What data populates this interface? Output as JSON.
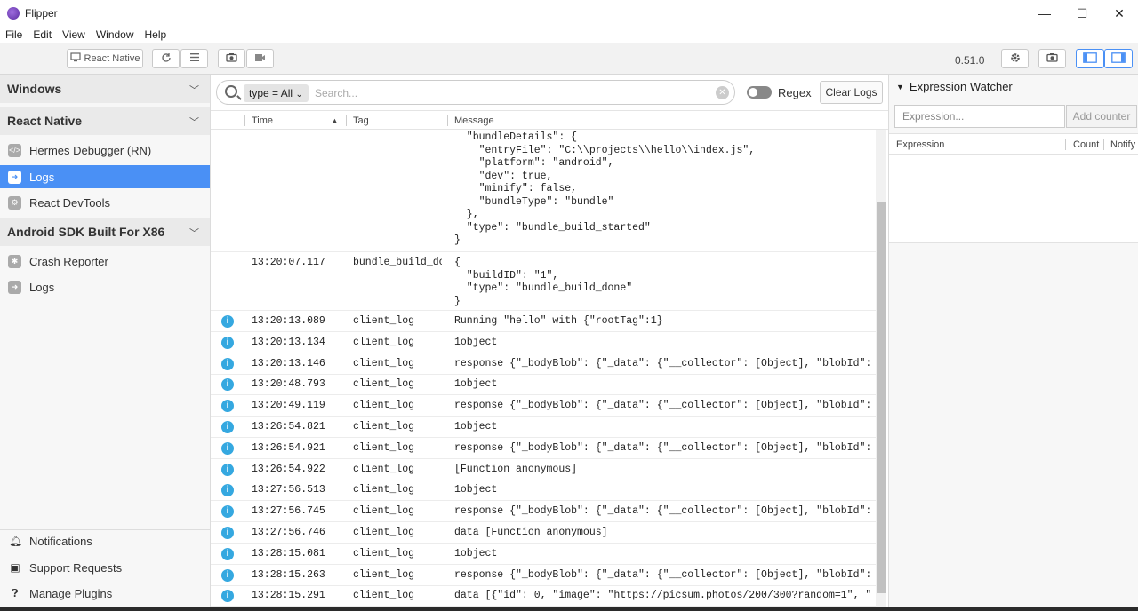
{
  "window": {
    "title": "Flipper",
    "minimize": "—",
    "maximize": "☐",
    "close": "✕"
  },
  "menu": [
    "File",
    "Edit",
    "View",
    "Window",
    "Help"
  ],
  "toolbar": {
    "device_button": "React Native",
    "version": "0.51.0"
  },
  "sidebar": {
    "sections": [
      {
        "title": "Windows"
      },
      {
        "title": "React Native",
        "items": [
          "Hermes Debugger (RN)",
          "Logs",
          "React DevTools"
        ]
      },
      {
        "title": "Android SDK Built For X86",
        "items": [
          "Crash Reporter",
          "Logs"
        ]
      }
    ],
    "footer": [
      "Notifications",
      "Support Requests",
      "Manage Plugins"
    ]
  },
  "logs": {
    "filter_token": "type = All",
    "search_placeholder": "Search...",
    "regex_label": "Regex",
    "clear_button": "Clear Logs",
    "columns": {
      "time": "Time",
      "tag": "Tag",
      "message": "Message"
    },
    "json_block_1": "  \"bundleDetails\": {\n    \"entryFile\": \"C:\\\\projects\\\\hello\\\\index.js\",\n    \"platform\": \"android\",\n    \"dev\": true,\n    \"minify\": false,\n    \"bundleType\": \"bundle\"\n  },\n  \"type\": \"bundle_build_started\"\n}",
    "entry_2": {
      "time": "13:20:07.117",
      "tag": "bundle_build_done",
      "message": "{\n  \"buildID\": \"1\",\n  \"type\": \"bundle_build_done\"\n}"
    },
    "rows": [
      {
        "time": "13:20:13.089",
        "tag": "client_log",
        "message": "Running \"hello\" with {\"rootTag\":1}"
      },
      {
        "time": "13:20:13.134",
        "tag": "client_log",
        "message": "1object"
      },
      {
        "time": "13:20:13.146",
        "tag": "client_log",
        "message": "response {\"_bodyBlob\": {\"_data\": {\"__collector\": [Object], \"blobId\":"
      },
      {
        "time": "13:20:48.793",
        "tag": "client_log",
        "message": "1object"
      },
      {
        "time": "13:20:49.119",
        "tag": "client_log",
        "message": "response {\"_bodyBlob\": {\"_data\": {\"__collector\": [Object], \"blobId\":"
      },
      {
        "time": "13:26:54.821",
        "tag": "client_log",
        "message": "1object"
      },
      {
        "time": "13:26:54.921",
        "tag": "client_log",
        "message": "response {\"_bodyBlob\": {\"_data\": {\"__collector\": [Object], \"blobId\":"
      },
      {
        "time": "13:26:54.922",
        "tag": "client_log",
        "message": "[Function anonymous]"
      },
      {
        "time": "13:27:56.513",
        "tag": "client_log",
        "message": "1object"
      },
      {
        "time": "13:27:56.745",
        "tag": "client_log",
        "message": "response {\"_bodyBlob\": {\"_data\": {\"__collector\": [Object], \"blobId\":"
      },
      {
        "time": "13:27:56.746",
        "tag": "client_log",
        "message": "data [Function anonymous]"
      },
      {
        "time": "13:28:15.081",
        "tag": "client_log",
        "message": "1object"
      },
      {
        "time": "13:28:15.263",
        "tag": "client_log",
        "message": "response {\"_bodyBlob\": {\"_data\": {\"__collector\": [Object], \"blobId\":"
      },
      {
        "time": "13:28:15.291",
        "tag": "client_log",
        "message": "data [{\"id\": 0, \"image\": \"https://picsum.photos/200/300?random=1\", \""
      }
    ],
    "level_icon": "i"
  },
  "expression_watcher": {
    "title": "Expression Watcher",
    "input_placeholder": "Expression...",
    "add_button": "Add counter",
    "columns": [
      "Expression",
      "Count",
      "Notify"
    ]
  },
  "colors": {
    "accent": "#4a90f5",
    "info": "#35a8e0"
  }
}
